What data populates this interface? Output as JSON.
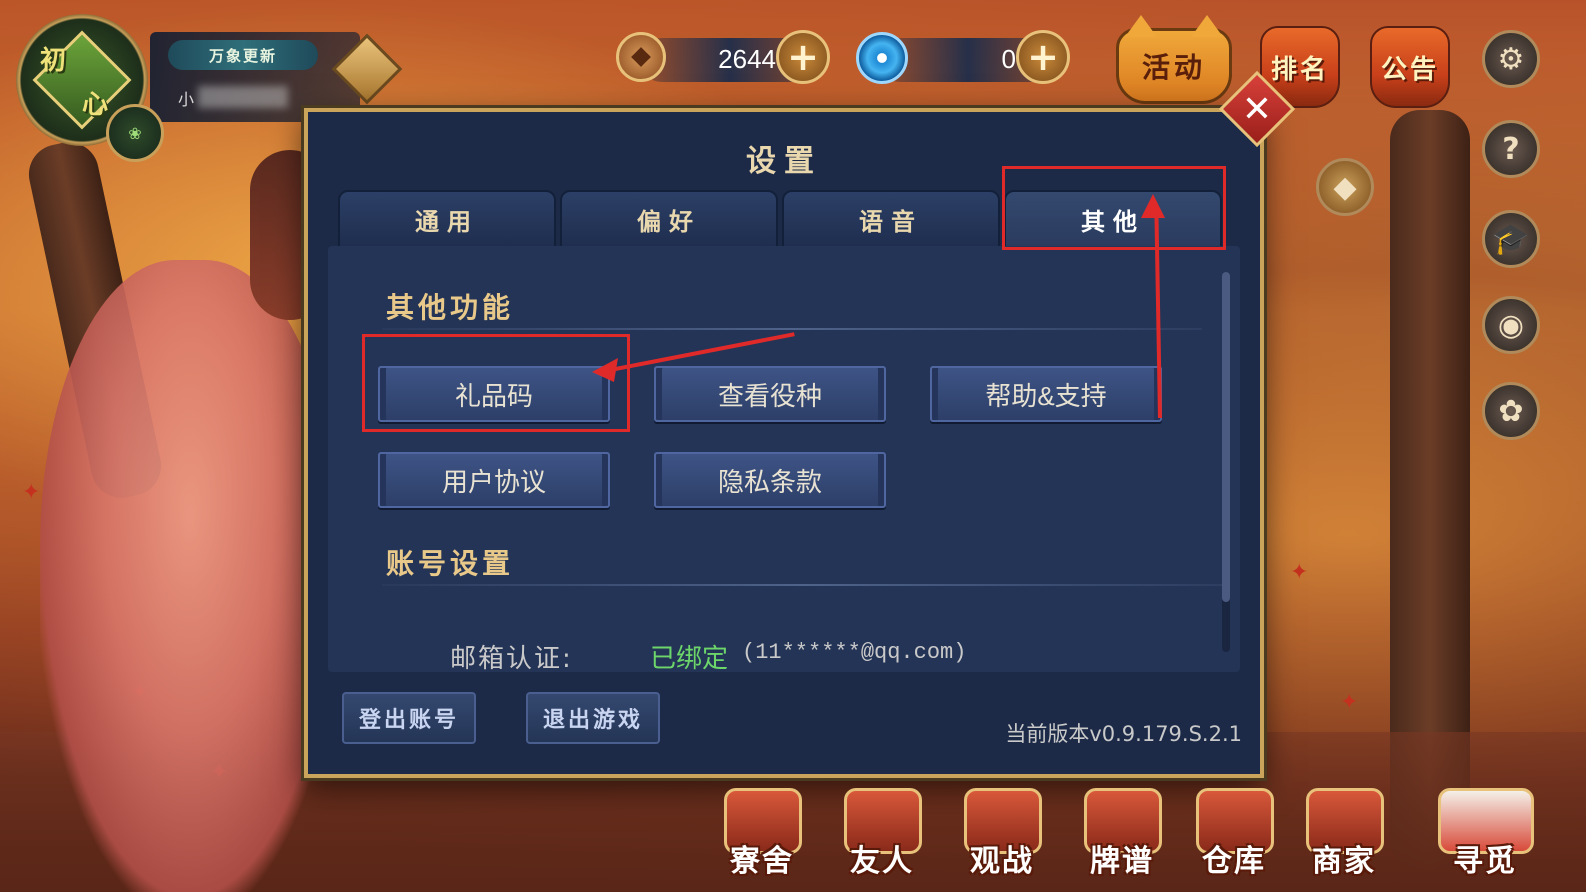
{
  "player": {
    "avatar_text_1": "初",
    "avatar_text_2": "心",
    "title_tag": "万象更新",
    "name_initial": "小"
  },
  "currency": {
    "coins": "2644",
    "jade": "0",
    "plus": "+"
  },
  "top_menu": {
    "activity": "活动",
    "ranking": "排名",
    "notice": "公告",
    "help": "?"
  },
  "settings": {
    "title": "设置",
    "close": "✕",
    "tabs": [
      {
        "label": "通用"
      },
      {
        "label": "偏好"
      },
      {
        "label": "语音"
      },
      {
        "label": "其他"
      }
    ],
    "active_tab": "其他",
    "sections": {
      "other": {
        "title": "其他功能",
        "buttons": [
          "礼品码",
          "查看役种",
          "帮助&支持",
          "用户协议",
          "隐私条款"
        ]
      },
      "account": {
        "title": "账号设置",
        "email_label": "邮箱认证:",
        "email_status": "已绑定",
        "email_value": "(11******@qq.com)"
      }
    },
    "footer": {
      "logout": "登出账号",
      "exit": "退出游戏",
      "version": "当前版本v0.9.179.S.2.1"
    }
  },
  "bottom_menu": [
    {
      "label": "寮舍"
    },
    {
      "label": "友人"
    },
    {
      "label": "观战"
    },
    {
      "label": "牌谱"
    },
    {
      "label": "仓库"
    },
    {
      "label": "商家"
    },
    {
      "label": "寻觅"
    }
  ],
  "colors": {
    "panel_bg": "#1c2a48",
    "panel_border": "#c9a45a",
    "highlight": "#e02a2a",
    "bound_green": "#6cd66a"
  }
}
